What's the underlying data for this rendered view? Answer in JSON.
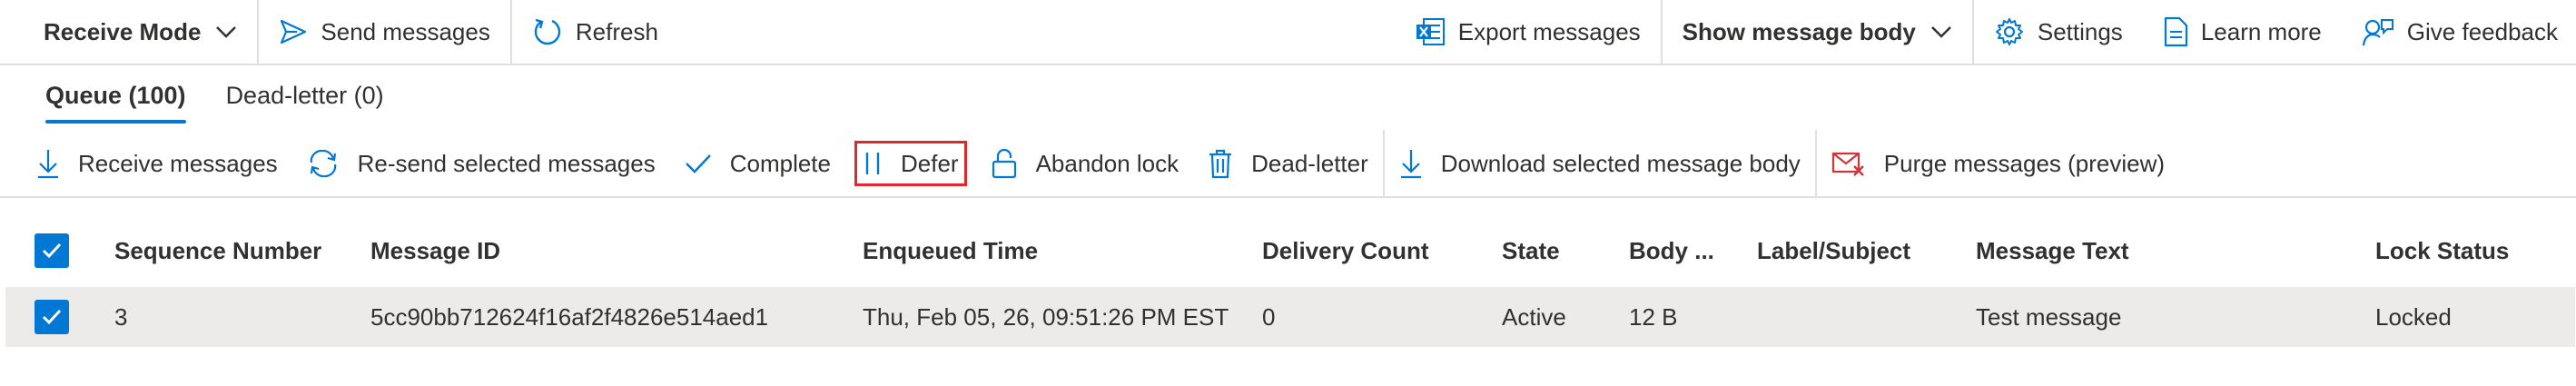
{
  "toolbar": {
    "receive_mode": "Receive Mode",
    "send_messages": "Send messages",
    "refresh": "Refresh",
    "export_messages": "Export messages",
    "show_message_body": "Show message body",
    "settings": "Settings",
    "learn_more": "Learn more",
    "give_feedback": "Give feedback"
  },
  "tabs": {
    "queue": "Queue (100)",
    "dead_letter": "Dead-letter (0)"
  },
  "actions": {
    "receive_messages": "Receive messages",
    "resend_selected": "Re-send selected messages",
    "complete": "Complete",
    "defer": "Defer",
    "abandon_lock": "Abandon lock",
    "dead_letter": "Dead-letter",
    "download_body": "Download selected message body",
    "purge_messages": "Purge messages (preview)"
  },
  "table": {
    "columns": {
      "sequence_number": "Sequence Number",
      "message_id": "Message ID",
      "enqueued_time": "Enqueued Time",
      "delivery_count": "Delivery Count",
      "state": "State",
      "body_size": "Body ...",
      "label_subject": "Label/Subject",
      "message_text": "Message Text",
      "lock_status": "Lock Status"
    },
    "rows": [
      {
        "sequence_number": "3",
        "message_id": "5cc90bb712624f16af2f4826e514aed1",
        "enqueued_time": "Thu, Feb 05, 26, 09:51:26 PM EST",
        "delivery_count": "0",
        "state": "Active",
        "body_size": "12 B",
        "label_subject": "",
        "message_text": "Test message",
        "lock_status": "Locked"
      }
    ]
  },
  "colors": {
    "accent": "#0078d4",
    "highlight_border": "#e0272b",
    "purge_icon": "#d13438"
  }
}
